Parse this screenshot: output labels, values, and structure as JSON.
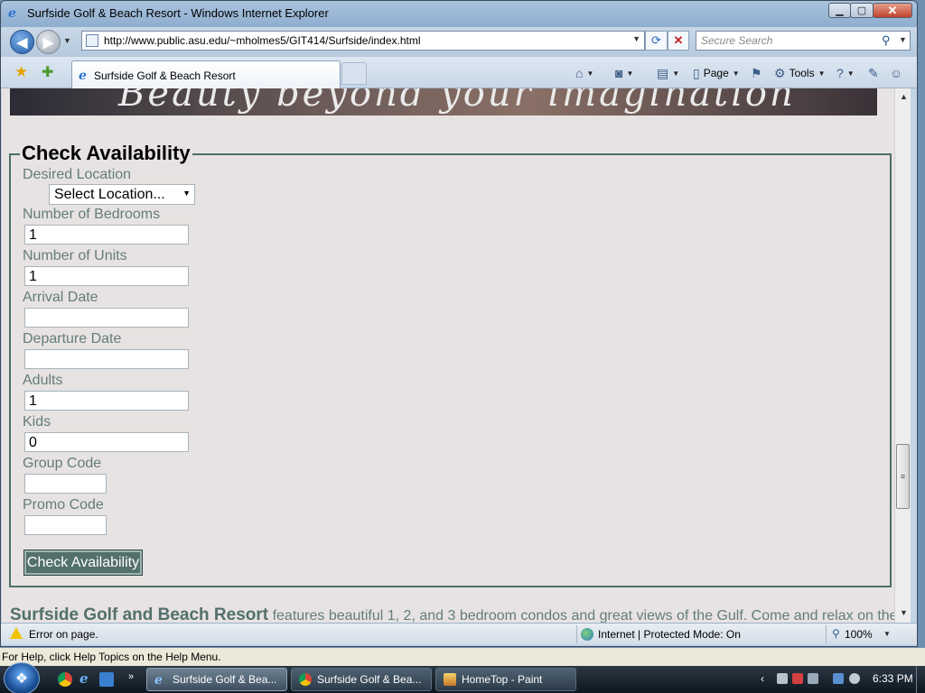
{
  "window": {
    "title": "Surfside Golf & Beach Resort - Windows Internet Explorer",
    "minimize": "▁",
    "maximize": "▢",
    "close": "✕"
  },
  "browser": {
    "url": "http://www.public.asu.edu/~mholmes5/GIT414/Surfside/index.html",
    "search_placeholder": "Secure Search",
    "tab_title": "Surfside Golf & Beach Resort",
    "commands": {
      "page": "Page",
      "tools": "Tools"
    }
  },
  "page": {
    "banner_text": "Beauty beyond your imagination",
    "form": {
      "legend": "Check Availability",
      "location_label": "Desired Location",
      "location_value": "Select Location...",
      "bedrooms_label": "Number of Bedrooms",
      "bedrooms_value": "1",
      "units_label": "Number of Units",
      "units_value": "1",
      "arrival_label": "Arrival Date",
      "arrival_value": "",
      "departure_label": "Departure Date",
      "departure_value": "",
      "adults_label": "Adults",
      "adults_value": "1",
      "kids_label": "Kids",
      "kids_value": "0",
      "group_label": "Group Code",
      "group_value": "",
      "promo_label": "Promo Code",
      "promo_value": "",
      "submit_label": "Check Availability"
    },
    "intro_strong": "Surfside Golf and Beach Resort",
    "intro_text": " features beautiful 1, 2, and 3 bedroom condos and great views of the Gulf. Come and relax on the"
  },
  "statusbar": {
    "message": "Error on page.",
    "zone": "Internet | Protected Mode: On",
    "zoom": "100%"
  },
  "helpline": "For Help, click Help Topics on the Help Menu.",
  "taskbar": {
    "items": [
      {
        "label": "Surfside Golf & Bea..."
      },
      {
        "label": "Surfside Golf & Bea..."
      },
      {
        "label": "HomeTop - Paint"
      }
    ],
    "clock": "6:33 PM"
  },
  "colors": {
    "accent": "#53706b",
    "label": "#647d78",
    "page_bg": "#e7e3e2"
  },
  "icons": [
    "ie-icon",
    "back-arrow-icon",
    "forward-arrow-icon",
    "refresh-icon",
    "stop-icon",
    "search-icon",
    "favorites-star-icon",
    "add-favorites-icon",
    "home-icon",
    "feeds-icon",
    "print-icon",
    "page-icon",
    "tools-gear-icon",
    "help-icon",
    "warning-icon",
    "globe-icon",
    "zoom-icon",
    "windows-start-icon"
  ]
}
